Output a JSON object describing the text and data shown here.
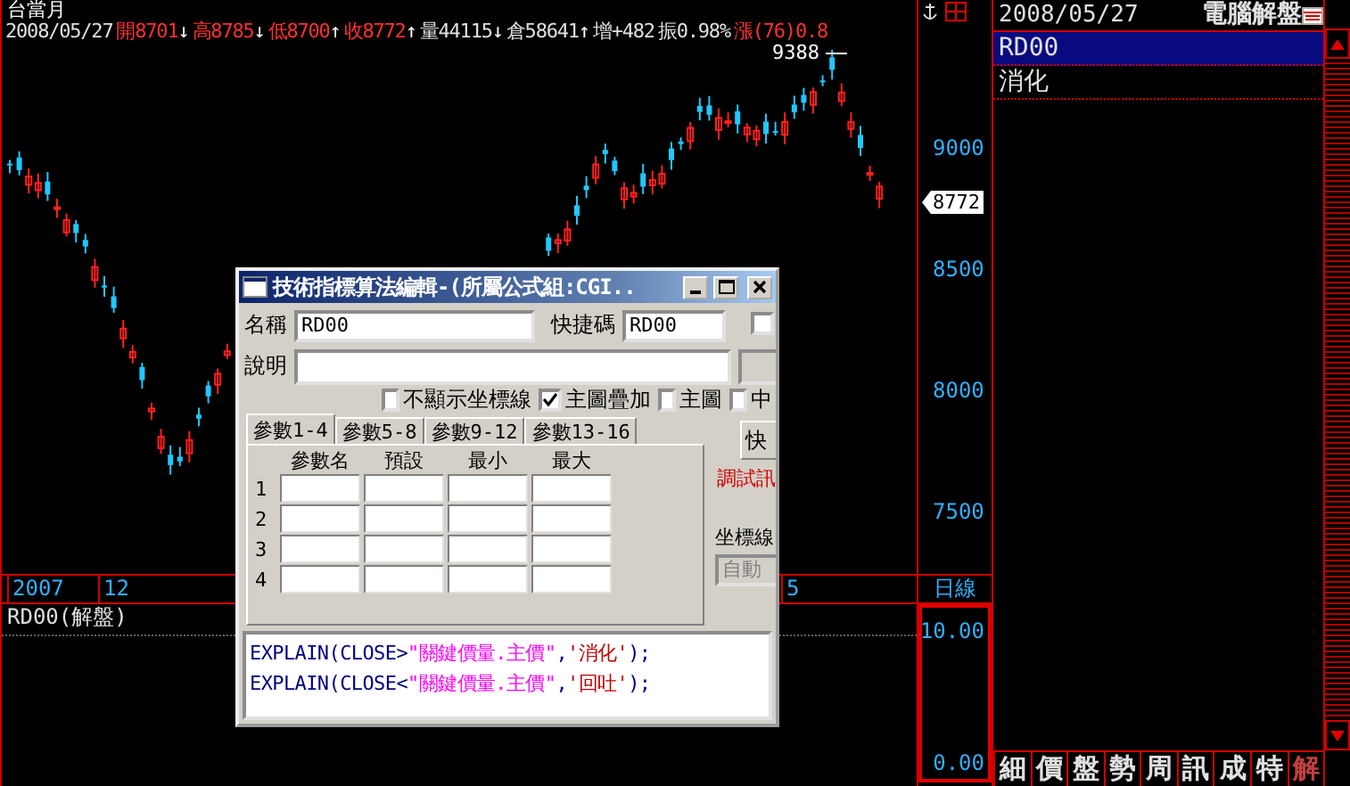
{
  "chart": {
    "title": "台當月",
    "quote": [
      {
        "text": "2008/05/27",
        "highlighted": false
      },
      {
        "text": "開8701",
        "highlighted": true,
        "arrow": "↓"
      },
      {
        "text": "高8785",
        "highlighted": true,
        "arrow": "↓"
      },
      {
        "text": "低8700",
        "highlighted": true,
        "arrow": "↑"
      },
      {
        "text": "收8772",
        "highlighted": true,
        "arrow": "↑"
      },
      {
        "text": "量44115",
        "highlighted": false,
        "arrow": "↓"
      },
      {
        "text": "倉58641",
        "highlighted": false,
        "arrow": "↑"
      },
      {
        "text": "增+482",
        "highlighted": false
      },
      {
        "text": "振0.98%",
        "highlighted": false
      },
      {
        "text": "漲(76)0.8",
        "highlighted": true
      }
    ],
    "high_label": "9388",
    "price_ticks": [
      "9000",
      "8500",
      "8000",
      "7500"
    ],
    "last_price": "8772",
    "date_labels": [
      "2007",
      "12",
      "5"
    ],
    "period": "日線"
  },
  "indicator": {
    "title": "RD00(解盤)",
    "ticks": [
      "10.00",
      "0.00"
    ]
  },
  "side_panel": {
    "date": "2008/05/27",
    "title": "電腦解盤",
    "items": [
      {
        "label": "RD00",
        "selected": true
      },
      {
        "label": "消化",
        "selected": false
      }
    ],
    "tabs": [
      {
        "label": "細",
        "selected": false
      },
      {
        "label": "價",
        "selected": false
      },
      {
        "label": "盤",
        "selected": false
      },
      {
        "label": "勢",
        "selected": false
      },
      {
        "label": "周",
        "selected": false
      },
      {
        "label": "訊",
        "selected": false
      },
      {
        "label": "成",
        "selected": false
      },
      {
        "label": "特",
        "selected": false
      },
      {
        "label": "解",
        "selected": true
      }
    ]
  },
  "dialog": {
    "title": "技術指標算法編輯-(所屬公式組:CGI..",
    "name_label": "名稱",
    "name_value": "RD00",
    "hotkey_label": "快捷碼",
    "hotkey_value": "RD00",
    "extra_checkbox": {
      "checked": false
    },
    "desc_label": "說明",
    "options": [
      {
        "label": "不顯示坐標線",
        "checked": false
      },
      {
        "label": "主圖疊加",
        "checked": true
      },
      {
        "label": "主圖",
        "checked": false
      },
      {
        "label": "中",
        "checked": false
      }
    ],
    "tabs": [
      {
        "label": "參數1-4",
        "selected": true
      },
      {
        "label": "參數5-8",
        "selected": false
      },
      {
        "label": "參數9-12",
        "selected": false
      },
      {
        "label": "參數13-16",
        "selected": false
      }
    ],
    "columns": [
      "參數名",
      "預設",
      "最小",
      "最大"
    ],
    "row_labels": [
      "1",
      "2",
      "3",
      "4"
    ],
    "side_button": "快",
    "debug_label": "調試訊",
    "axis_label": "坐標線",
    "axis_field": {
      "value": "自動",
      "disabled": true
    },
    "code_lines": [
      [
        {
          "text": "EXPLAIN(CLOSE>",
          "kind": "code"
        },
        {
          "text": "\"關鍵價量.主價\"",
          "kind": "string"
        },
        {
          "text": ",",
          "kind": "code"
        },
        {
          "text": "'消化'",
          "kind": "literal"
        },
        {
          "text": ");",
          "kind": "code"
        }
      ],
      [
        {
          "text": "EXPLAIN(CLOSE<",
          "kind": "code"
        },
        {
          "text": "\"關鍵價量.主價\"",
          "kind": "string"
        },
        {
          "text": ",",
          "kind": "code"
        },
        {
          "text": "'回吐'",
          "kind": "literal"
        },
        {
          "text": ");",
          "kind": "code"
        }
      ]
    ]
  }
}
